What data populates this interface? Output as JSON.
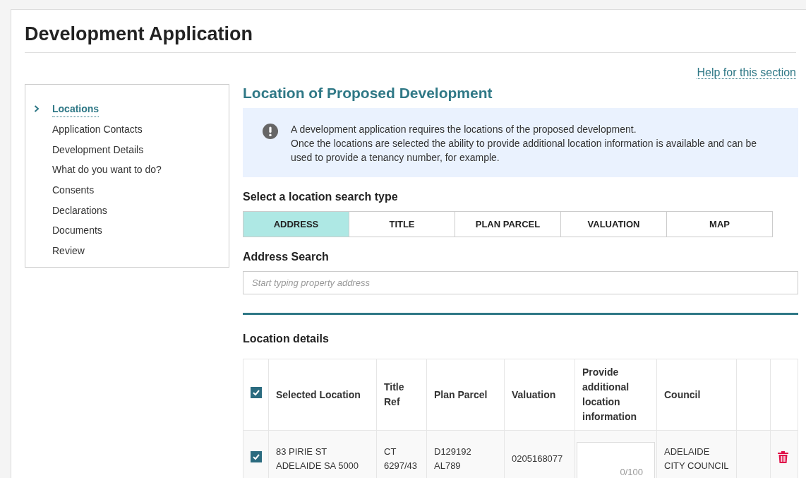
{
  "page": {
    "title": "Development Application",
    "help_link": "Help for this section"
  },
  "sidebar": {
    "items": [
      {
        "label": "Locations",
        "selected": true
      },
      {
        "label": "Application Contacts",
        "selected": false
      },
      {
        "label": "Development Details",
        "selected": false
      },
      {
        "label": "What do you want to do?",
        "selected": false
      },
      {
        "label": "Consents",
        "selected": false
      },
      {
        "label": "Declarations",
        "selected": false
      },
      {
        "label": "Documents",
        "selected": false
      },
      {
        "label": "Review",
        "selected": false
      }
    ]
  },
  "section": {
    "title": "Location of Proposed Development",
    "info": "A development application requires the locations of the proposed development.\nOnce the locations are selected the ability to provide additional location information is available and can be used to provide a tenancy number, for example."
  },
  "search_type": {
    "label": "Select a location search type",
    "tabs": [
      {
        "label": "ADDRESS",
        "selected": true
      },
      {
        "label": "TITLE",
        "selected": false
      },
      {
        "label": "PLAN PARCEL",
        "selected": false
      },
      {
        "label": "VALUATION",
        "selected": false
      },
      {
        "label": "MAP",
        "selected": false
      }
    ]
  },
  "address_search": {
    "label": "Address Search",
    "placeholder": "Start typing property address"
  },
  "location_details": {
    "title": "Location details",
    "select_all_checked": true,
    "columns": [
      "Selected Location",
      "Title Ref",
      "Plan Parcel",
      "Valuation",
      "Provide additional location information",
      "Council"
    ],
    "rows": [
      {
        "checked": true,
        "location": "83 PIRIE ST\nADELAIDE SA 5000",
        "title_ref": "CT\n6297/43",
        "plan_parcel": "D129192\nAL789",
        "valuation": "0205168077",
        "counter": "0/100",
        "council": "ADELAIDE\nCITY COUNCIL"
      }
    ]
  }
}
